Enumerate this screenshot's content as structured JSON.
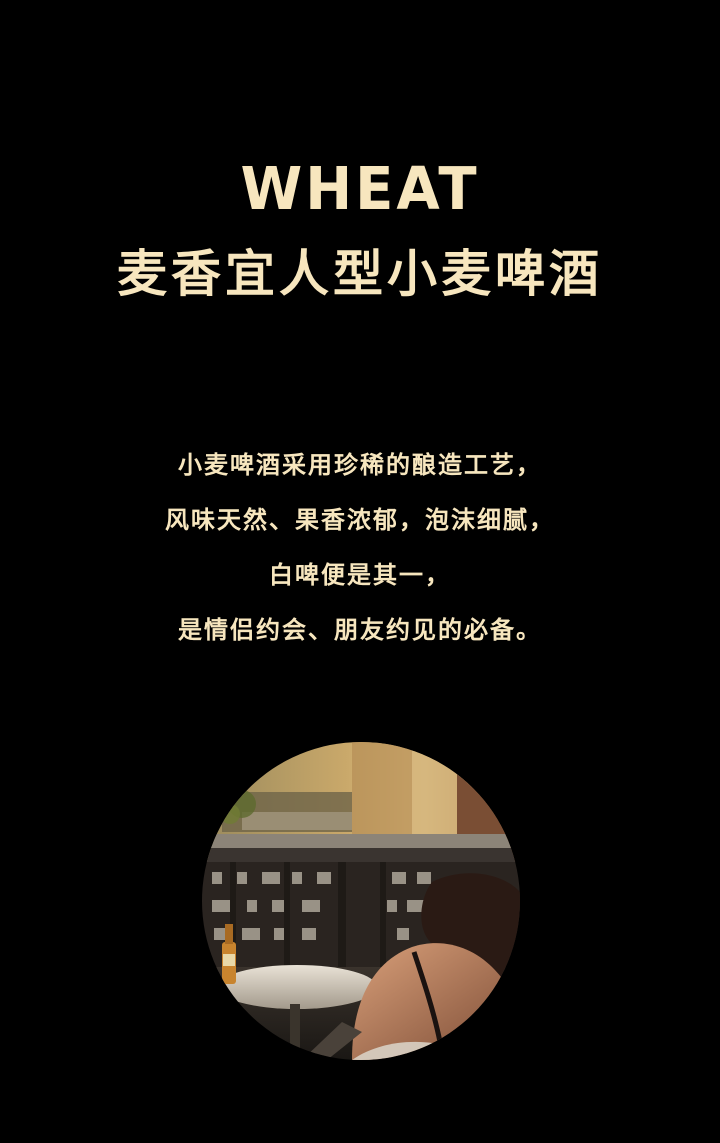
{
  "header": {
    "title_en": "WHEAT",
    "title_cn": "麦香宜人型小麦啤酒"
  },
  "description": {
    "lines": [
      "小麦啤酒采用珍稀的酿造工艺，",
      "风味天然、果香浓郁，泡沫细腻，",
      "白啤便是其一，",
      "是情侣约会、朋友约见的必备。"
    ]
  },
  "colors": {
    "background": "#000000",
    "text_accent": "#f7e6be"
  }
}
